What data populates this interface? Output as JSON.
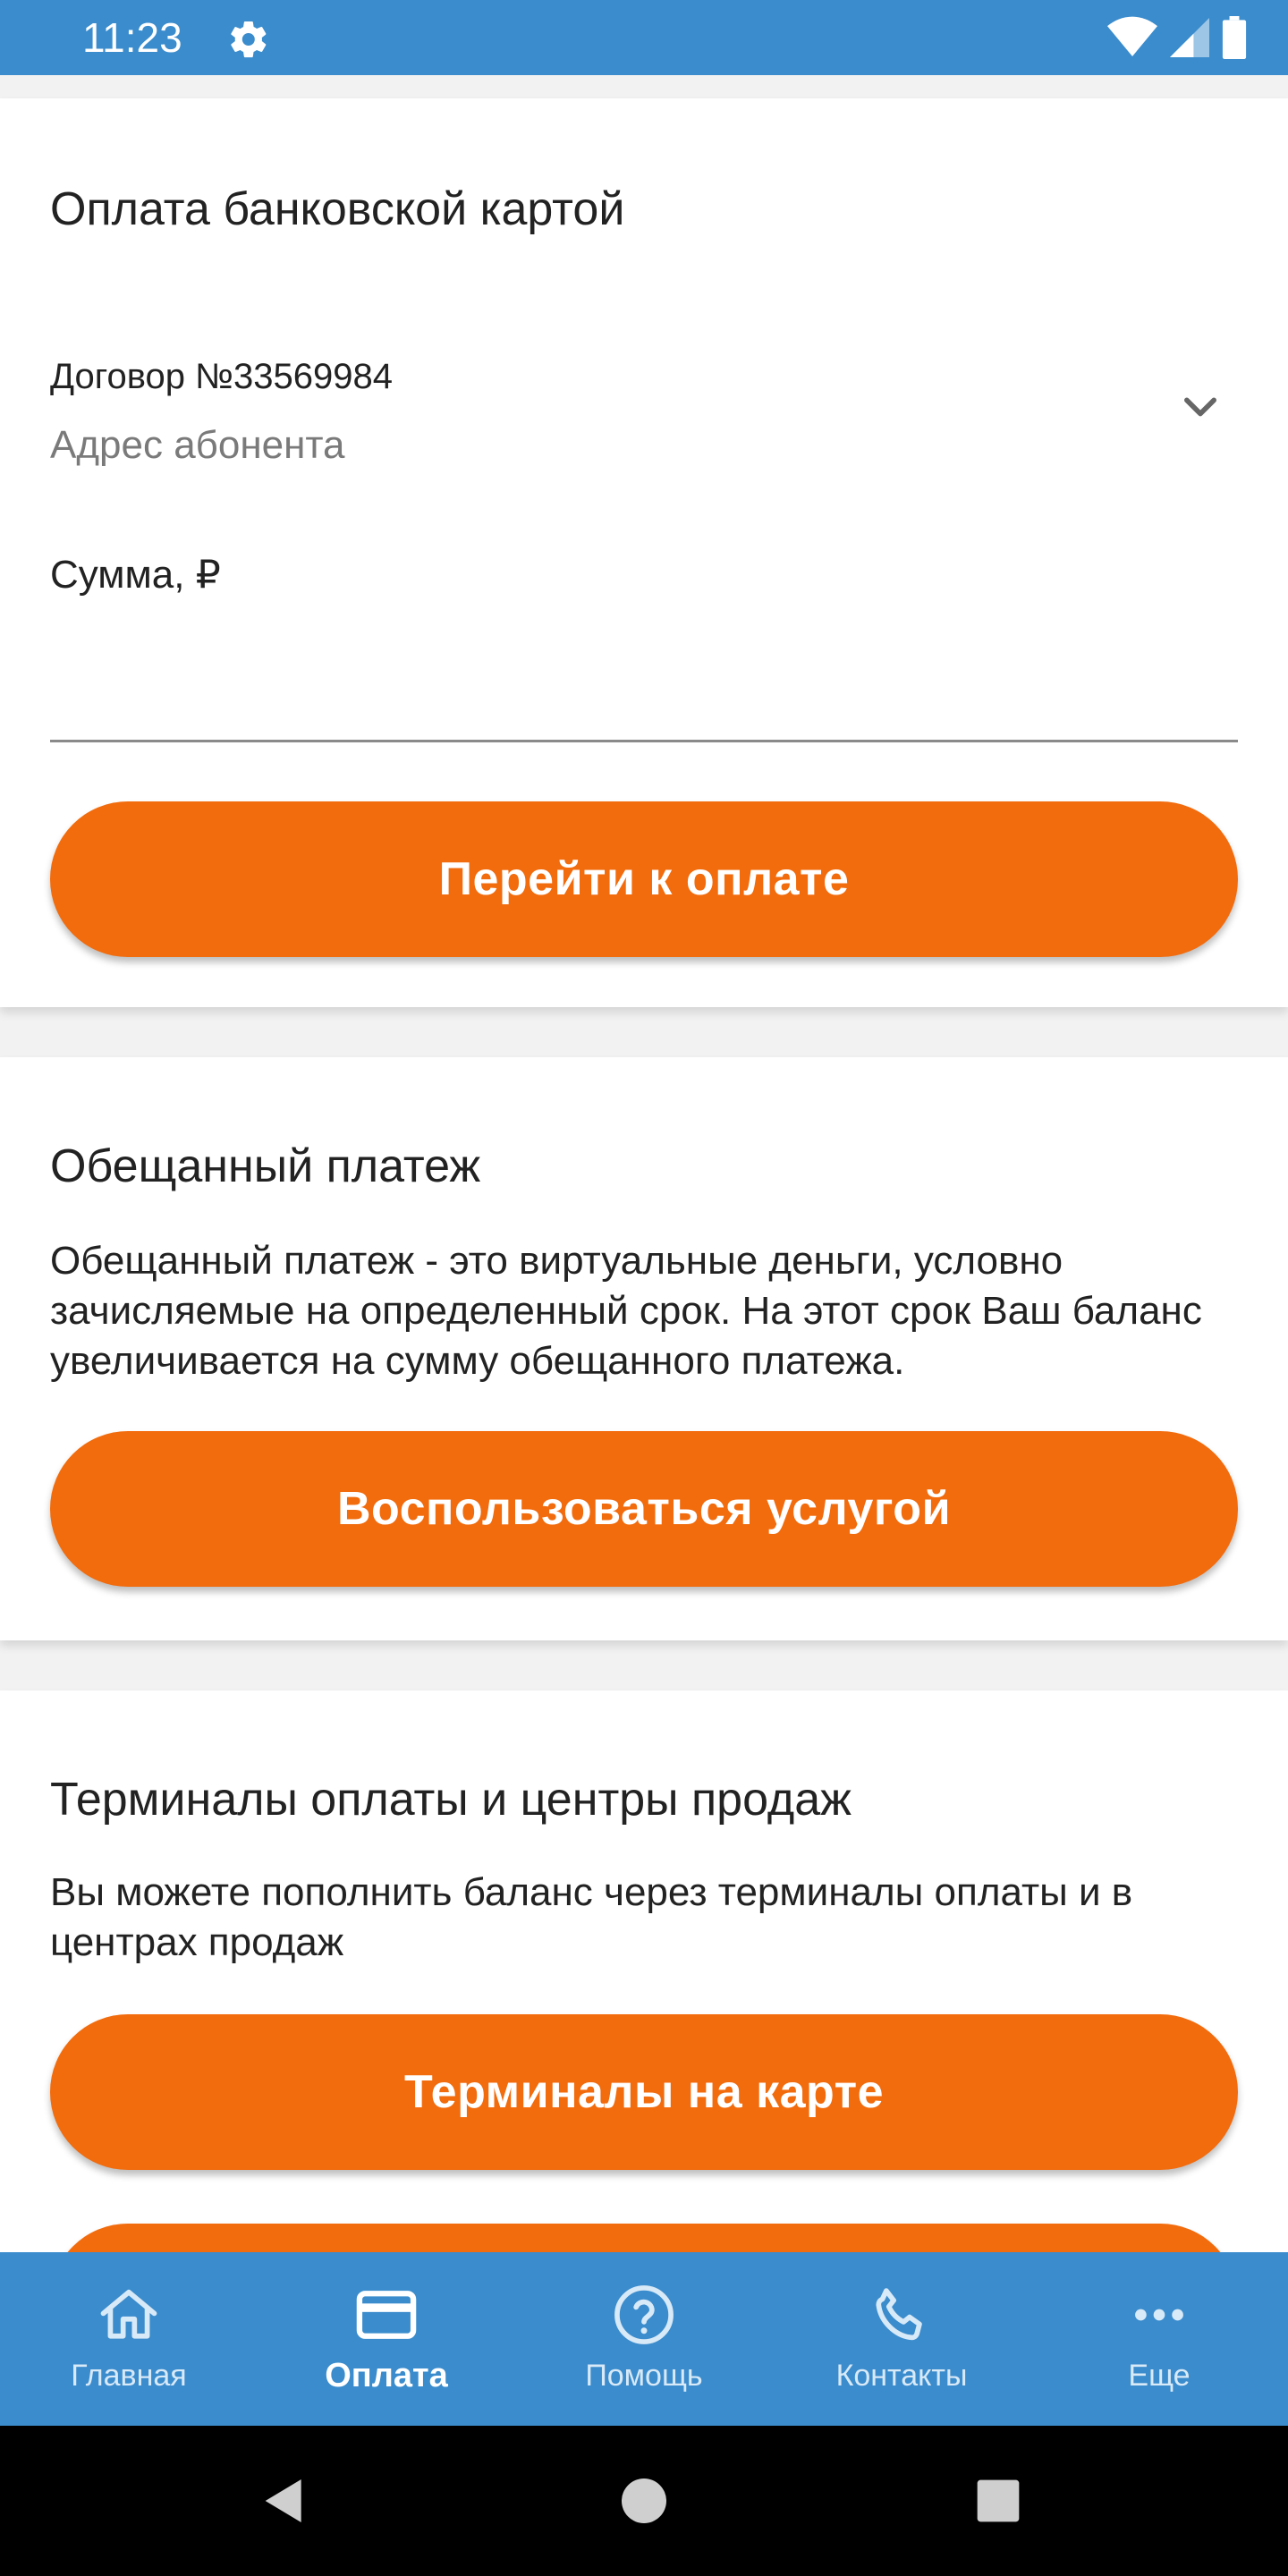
{
  "status_bar": {
    "time": "11:23"
  },
  "payment_card": {
    "title": "Оплата банковской картой",
    "contract_label": "Договор №33569984",
    "address_placeholder": "Адрес абонента",
    "sum_label": "Сумма, ₽",
    "sum_value": "",
    "pay_button": "Перейти к оплате"
  },
  "promised_payment": {
    "title": "Обещанный платеж",
    "description": "Обещанный платеж - это виртуальные деньги, условно зачисляемые на определенный срок. На этот срок Ваш баланс увеличивается на сумму обещанного платежа.",
    "button": "Воспользоваться услугой"
  },
  "terminals": {
    "title": "Терминалы оплаты и центры продаж",
    "description": "Вы можете пополнить баланс через терминалы оплаты и в центрах продаж",
    "map_button": "Терминалы на карте"
  },
  "bottom_nav": {
    "items": [
      {
        "label": "Главная",
        "icon": "home-icon"
      },
      {
        "label": "Оплата",
        "icon": "credit-card-icon"
      },
      {
        "label": "Помощь",
        "icon": "help-circle-icon"
      },
      {
        "label": "Контакты",
        "icon": "phone-icon"
      },
      {
        "label": "Еще",
        "icon": "more-dots-icon"
      }
    ],
    "active": "Оплата"
  },
  "colors": {
    "primary_blue": "#3a8ccd",
    "accent_orange": "#f26b0c"
  }
}
